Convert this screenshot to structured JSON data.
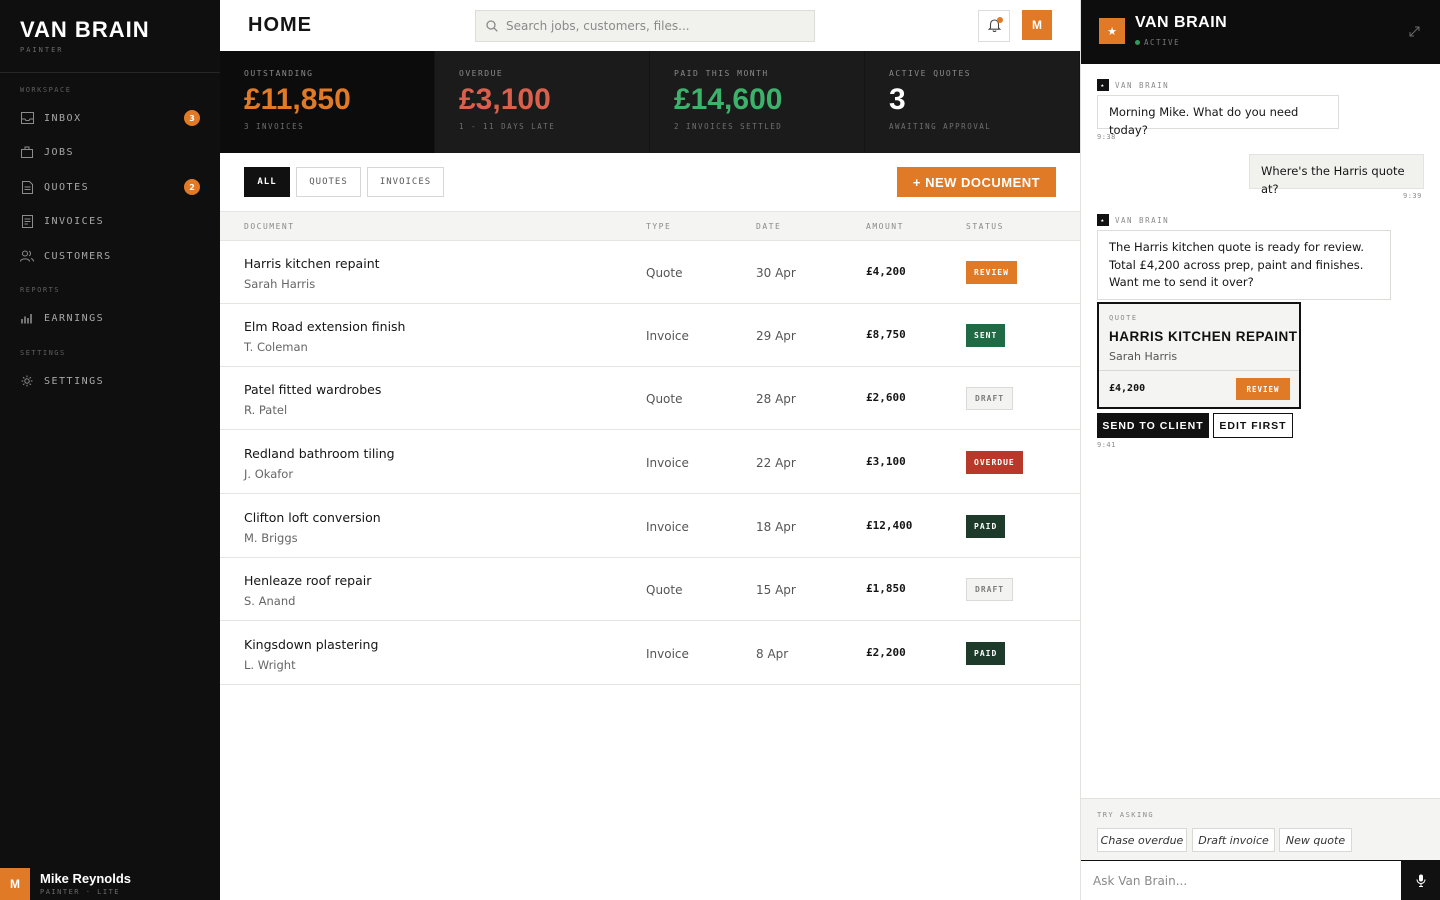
{
  "brand": {
    "name": "VAN BRAIN",
    "subtitle": "PAINTER"
  },
  "sidebar": {
    "sections": {
      "workspace": "WORKSPACE",
      "reports": "REPORTS",
      "settings": "SETTINGS"
    },
    "items": [
      {
        "label": "INBOX",
        "icon": "inbox-icon",
        "badge": "3"
      },
      {
        "label": "JOBS",
        "icon": "briefcase-icon"
      },
      {
        "label": "QUOTES",
        "icon": "document-icon",
        "badge": "2"
      },
      {
        "label": "INVOICES",
        "icon": "receipt-icon"
      },
      {
        "label": "CUSTOMERS",
        "icon": "users-icon"
      },
      {
        "label": "EARNINGS",
        "icon": "bar-chart-icon"
      },
      {
        "label": "SETTINGS",
        "icon": "gear-icon"
      }
    ],
    "user": {
      "initial": "M",
      "name": "Mike Reynolds",
      "role": "PAINTER · LITE"
    }
  },
  "header": {
    "title": "HOME",
    "search_placeholder": "Search jobs, customers, files...",
    "avatar_initial": "M"
  },
  "stats": [
    {
      "label": "OUTSTANDING",
      "value": "£11,850",
      "sub": "3 INVOICES",
      "color": "#e07a27"
    },
    {
      "label": "OVERDUE",
      "value": "£3,100",
      "sub": "1 - 11 DAYS LATE",
      "color": "#d9604d"
    },
    {
      "label": "PAID THIS MONTH",
      "value": "£14,600",
      "sub": "2 INVOICES SETTLED",
      "color": "#3db26b"
    },
    {
      "label": "ACTIVE QUOTES",
      "value": "3",
      "sub": "AWAITING APPROVAL",
      "color": "#ffffff"
    }
  ],
  "filters": [
    "ALL",
    "QUOTES",
    "INVOICES"
  ],
  "active_filter": "ALL",
  "new_document_label": "+ NEW DOCUMENT",
  "table": {
    "headers": {
      "document": "DOCUMENT",
      "type": "TYPE",
      "date": "DATE",
      "amount": "AMOUNT",
      "status": "STATUS"
    },
    "rows": [
      {
        "title": "Harris kitchen repaint",
        "client": "Sarah Harris",
        "type": "Quote",
        "date": "30 Apr",
        "amount": "£4,200",
        "status": "REVIEW",
        "status_kind": "review"
      },
      {
        "title": "Elm Road extension finish",
        "client": "T. Coleman",
        "type": "Invoice",
        "date": "29 Apr",
        "amount": "£8,750",
        "status": "SENT",
        "status_kind": "sent"
      },
      {
        "title": "Patel fitted wardrobes",
        "client": "R. Patel",
        "type": "Quote",
        "date": "28 Apr",
        "amount": "£2,600",
        "status": "DRAFT",
        "status_kind": "draft"
      },
      {
        "title": "Redland bathroom tiling",
        "client": "J. Okafor",
        "type": "Invoice",
        "date": "22 Apr",
        "amount": "£3,100",
        "status": "OVERDUE",
        "status_kind": "overdue"
      },
      {
        "title": "Clifton loft conversion",
        "client": "M. Briggs",
        "type": "Invoice",
        "date": "18 Apr",
        "amount": "£12,400",
        "status": "PAID",
        "status_kind": "paid"
      },
      {
        "title": "Henleaze roof repair",
        "client": "S. Anand",
        "type": "Quote",
        "date": "15 Apr",
        "amount": "£1,850",
        "status": "DRAFT",
        "status_kind": "draft"
      },
      {
        "title": "Kingsdown plastering",
        "client": "L. Wright",
        "type": "Invoice",
        "date": "8 Apr",
        "amount": "£2,200",
        "status": "PAID",
        "status_kind": "paid"
      }
    ]
  },
  "assistant": {
    "title": "VAN BRAIN",
    "status": "ACTIVE",
    "author_label": "VAN BRAIN",
    "messages": {
      "m1": {
        "text": "Morning Mike. What do you need today?",
        "time": "9:38"
      },
      "m2": {
        "text": "Where's the Harris quote at?",
        "time": "9:39"
      },
      "m3": {
        "text": "The Harris kitchen quote is ready for review. Total £4,200 across prep, paint and finishes. Want me to send it over?",
        "time": "9:41"
      }
    },
    "quote_card": {
      "label": "QUOTE",
      "title": "HARRIS KITCHEN REPAINT",
      "client": "Sarah Harris",
      "amount": "£4,200",
      "status": "REVIEW"
    },
    "actions": {
      "primary": "SEND TO CLIENT",
      "secondary": "EDIT FIRST"
    },
    "suggest_label": "TRY ASKING",
    "suggestions": [
      "Chase overdue",
      "Draft invoice",
      "New quote"
    ],
    "input_placeholder": "Ask Van Brain..."
  }
}
